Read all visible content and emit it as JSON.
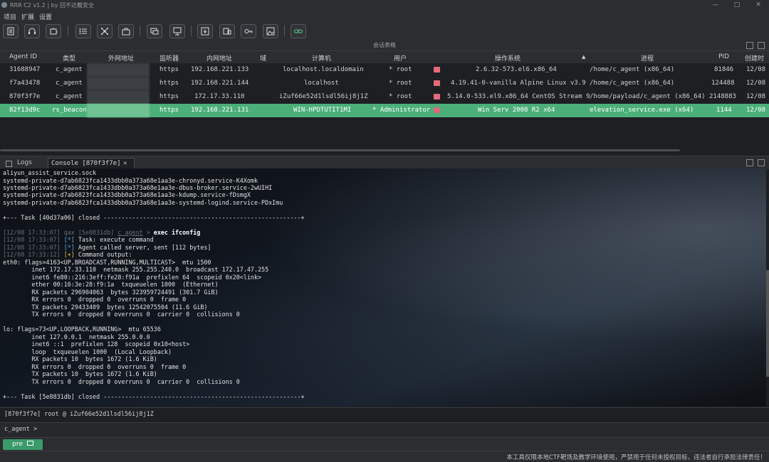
{
  "window": {
    "title": "RRR C2 v1.2 | by 回不达戴安全"
  },
  "menu": [
    "项目",
    "扩展",
    "设置"
  ],
  "toolbar": {
    "icons": [
      "document-icon",
      "headset-icon",
      "puzzle-icon",
      "list-icon",
      "network-icon",
      "briefcase-icon",
      "chat-icon",
      "monitor-icon",
      "download-icon",
      "device-icon",
      "key-icon",
      "image-icon",
      "link-icon"
    ]
  },
  "session": {
    "title": "会话表格",
    "columns": [
      "Agent ID",
      "类型",
      "外网地址",
      "监听器",
      "内网地址",
      "域",
      "计算机",
      "用户",
      "操作系统",
      "▲",
      "进程",
      "PID",
      "创建时"
    ],
    "rows": [
      {
        "id": "31688947",
        "type": "c_agent",
        "listener": "https",
        "ip": "192.168.221.133",
        "domain": "",
        "computer": "localhost.localdomain",
        "user": "* root",
        "os": "2.6.32-573.el6.x86_64",
        "process": "/home/c_agent (x86_64)",
        "pid": "81846",
        "created": "12/08"
      },
      {
        "id": "f7a43478",
        "type": "c_agent",
        "listener": "https",
        "ip": "192.168.221.144",
        "domain": "",
        "computer": "localhost",
        "user": "* root",
        "os": "4.19.41-0-vanilla Alpine Linux v3.9",
        "process": "/home/c_agent (x86_64)",
        "pid": "124488",
        "created": "12/08"
      },
      {
        "id": "870f3f7e",
        "type": "c_agent",
        "listener": "https",
        "ip": "172.17.33.110",
        "domain": "",
        "computer": "iZuf66e52d1lsdl56ij8j1Z",
        "user": "* root",
        "os": "5.14.0-533.el9.x86_64 CentOS Stream 9",
        "process": "/home/payload/c_agent (x86_64)",
        "pid": "2148883",
        "created": "12/08"
      },
      {
        "id": "82f13d9c",
        "type": "rs_beacon",
        "listener": "https",
        "ip": "192.168.221.131",
        "domain": "",
        "computer": "WIN-HPDTUTIT1MI",
        "user": "* Administrator",
        "os": "Win Serv 2008 R2 x64",
        "process": "elevation_service.exe (x64)",
        "pid": "1144",
        "created": "12/08"
      }
    ]
  },
  "tabs": {
    "logs": "Logs",
    "console": "Console [870f3f7e]"
  },
  "console": {
    "lines": [
      "aliyun_assist_service.sock",
      "systemd-private-d7ab6823fca1433dbb0a373a68e1aa3e-chronyd.service-K4Xomk",
      "systemd-private-d7ab6823fca1433dbb0a373a68e1aa3e-dbus-broker.service-2wUIHI",
      "systemd-private-d7ab6823fca1433dbb0a373a68e1aa3e-kdump.service-fDsmgX",
      "systemd-private-d7ab6823fca1433dbb0a373a68e1aa3e-systemd-logind.service-PDxImu",
      "",
      "+--- Task [40d37a06] closed -------------------------------------------------------+",
      "",
      "[12/08 17:33:07] qax [5e8831db] c_agent > exec ifconfig",
      "[12/08 17:33:07] [*] Task: execute command",
      "[12/08 17:33:07] [*] Agent called server, sent [112 bytes]",
      "[12/08 17:33:12] [+] Command output:",
      "eth0: flags=4163<UP,BROADCAST,RUNNING,MULTICAST>  mtu 1500",
      "        inet 172.17.33.110  netmask 255.255.240.0  broadcast 172.17.47.255",
      "        inet6 fe80::216:3eff:fe28:f91a  prefixlen 64  scopeid 0x20<link>",
      "        ether 00:16:3e:28:f9:1a  txqueuelen 1000  (Ethernet)",
      "        RX packets 296904063  bytes 323959724491 (301.7 GiB)",
      "        RX errors 0  dropped 0  overruns 0  frame 0",
      "        TX packets 29433409  bytes 12542075504 (11.6 GiB)",
      "        TX errors 0  dropped 0 overruns 0  carrier 0  collisions 0",
      "",
      "lo: flags=73<UP,LOOPBACK,RUNNING>  mtu 65536",
      "        inet 127.0.0.1  netmask 255.0.0.0",
      "        inet6 ::1  prefixlen 128  scopeid 0x10<host>",
      "        loop  txqueuelen 1000  (Local Loopback)",
      "        RX packets 10  bytes 1672 (1.6 KiB)",
      "        RX errors 0  dropped 0  overruns 0  frame 0",
      "        TX packets 10  bytes 1672 (1.6 KiB)",
      "        TX errors 0  dropped 0 overruns 0  carrier 0  collisions 0",
      "",
      "+--- Task [5e8831db] closed -------------------------------------------------------+"
    ]
  },
  "prompt": {
    "info": "[870f3f7e] root @ iZuf66e52d1lsdl56ij8j1Z",
    "input": "c_agent >"
  },
  "bottom": {
    "tab": "pre"
  },
  "status": {
    "text": "本工具仅限本地CTF靶场及教学环境使用，严禁用于任何未授权目标，违法者自行承担法律责任！"
  }
}
